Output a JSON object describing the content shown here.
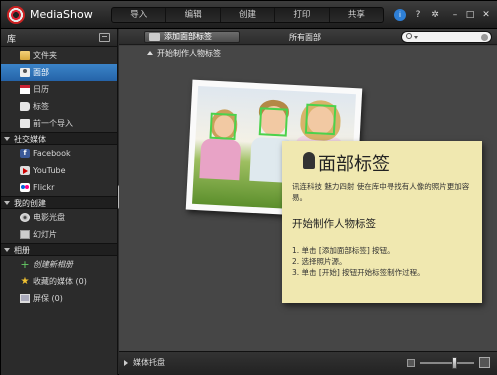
{
  "app": {
    "title": "MediaShow"
  },
  "nav": [
    "导入",
    "编辑",
    "创建",
    "打印",
    "共享"
  ],
  "sidebar": {
    "header": "库",
    "library": [
      {
        "label": "文件夹",
        "icon": "folder-icon",
        "selected": false
      },
      {
        "label": "面部",
        "icon": "face-icon",
        "selected": true
      },
      {
        "label": "日历",
        "icon": "calendar-icon",
        "selected": false
      },
      {
        "label": "标签",
        "icon": "tag-icon",
        "selected": false
      },
      {
        "label": "前一个导入",
        "icon": "import-icon",
        "selected": false
      }
    ],
    "sections": [
      {
        "title": "社交媒体",
        "items": [
          {
            "label": "Facebook",
            "icon": "facebook-icon"
          },
          {
            "label": "YouTube",
            "icon": "youtube-icon"
          },
          {
            "label": "Flickr",
            "icon": "flickr-icon"
          }
        ]
      },
      {
        "title": "我的创建",
        "items": [
          {
            "label": "电影光盘",
            "icon": "disc-icon"
          },
          {
            "label": "幻灯片",
            "icon": "slideshow-icon"
          }
        ]
      },
      {
        "title": "相册",
        "items": [
          {
            "label": "创建新相册",
            "icon": "plus-icon",
            "italic": true
          },
          {
            "label": "收藏的媒体 (0)",
            "icon": "star-icon"
          },
          {
            "label": "屏保 (0)",
            "icon": "monitor-icon"
          }
        ]
      }
    ]
  },
  "toolbar": {
    "add_tag": "添加面部标签",
    "all_faces": "所有面部"
  },
  "group_header": "开始制作人物标签",
  "note": {
    "title": "面部标签",
    "description": "讯连科技 魅力四射 使在库中寻找有人像的照片更加容易。",
    "subtitle": "开始制作人物标签",
    "steps": [
      "1. 单击 [添加面部标签] 按钮。",
      "2. 选择照片源。",
      "3. 单击 [开始] 按钮开始标签制作过程。"
    ]
  },
  "tray": {
    "label": "媒体托盘",
    "zoom_level": 0.65
  },
  "colors": {
    "selection": "#2e6fb5",
    "face_box": "#4cd24c",
    "note_bg": "#f0e8b0"
  }
}
